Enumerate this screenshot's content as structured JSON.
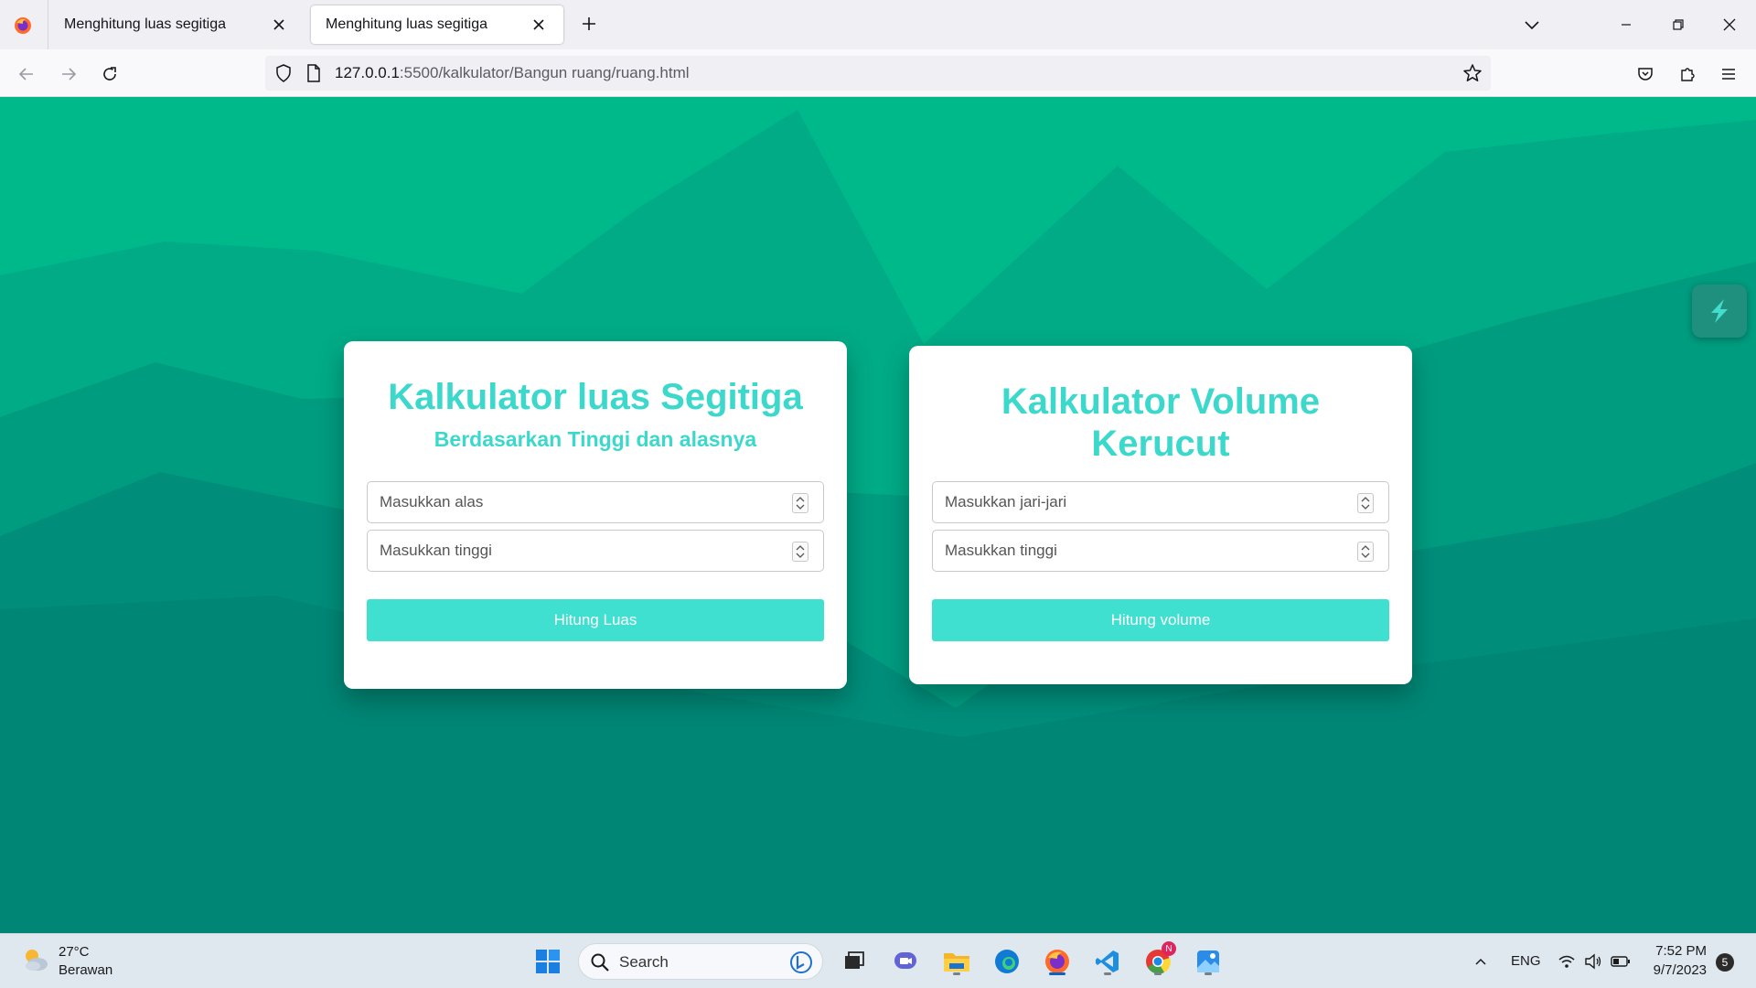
{
  "browser": {
    "tabs": [
      {
        "title": "Menghitung luas segitiga",
        "active": false
      },
      {
        "title": "Menghitung luas segitiga",
        "active": true
      }
    ],
    "url_host": "127.0.0.1",
    "url_rest": ":5500/kalkulator/Bangun ruang/ruang.html"
  },
  "page": {
    "background_color": "#00b98b",
    "accent_color": "#40e0d0",
    "triangle_card": {
      "title": "Kalkulator luas Segitiga",
      "subtitle": "Berdasarkan Tinggi dan alasnya",
      "input_base_placeholder": "Masukkan alas",
      "input_height_placeholder": "Masukkan tinggi",
      "button_label": "Hitung Luas"
    },
    "cone_card": {
      "title": "Kalkulator Volume Kerucut",
      "input_radius_placeholder": "Masukkan jari-jari",
      "input_height_placeholder": "Masukkan tinggi",
      "button_label": "Hitung volume"
    }
  },
  "taskbar": {
    "weather_temp": "27°C",
    "weather_desc": "Berawan",
    "search_label": "Search",
    "language": "ENG",
    "time": "7:52 PM",
    "date": "9/7/2023",
    "notification_count": "5",
    "chrome_badge": "N"
  }
}
